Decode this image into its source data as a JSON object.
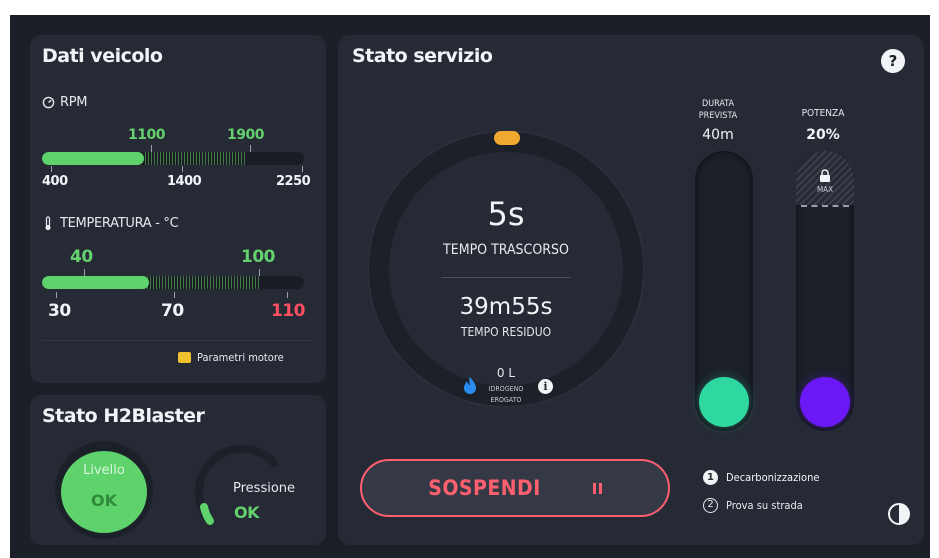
{
  "vehicle": {
    "title": "Dati veicolo",
    "rpm": {
      "label": "RPM",
      "range_low": "1100",
      "range_high": "1900",
      "scale_min": "400",
      "scale_mid": "1400",
      "scale_max": "2250",
      "current_fill": 0.39
    },
    "temperature": {
      "label": "TEMPERATURA - °C",
      "range_low": "40",
      "range_high": "100",
      "scale_min": "30",
      "scale_mid": "70",
      "scale_max": "110",
      "current_fill": 0.41
    },
    "engine_params_link": "Parametri motore"
  },
  "h2blaster": {
    "title": "Stato H2Blaster",
    "level_label": "Livello",
    "level_value": "OK",
    "pressure_label": "Pressione",
    "pressure_value": "OK"
  },
  "service": {
    "title": "Stato servizio",
    "help_icon_glyph": "?",
    "elapsed_value": "5s",
    "elapsed_label": "TEMPO TRASCORSO",
    "remaining_value": "39m55s",
    "remaining_label": "TEMPO RESIDUO",
    "hydrogen_value": "0 L",
    "hydrogen_label_1": "IDROGENO",
    "hydrogen_label_2": "EROGATO",
    "duration_label_1": "DURATA",
    "duration_label_2": "PREVISTA",
    "duration_value": "40m",
    "power_label": "POTENZA",
    "power_value": "20%",
    "power_max_label": "MAX",
    "suspend_button": "SOSPENDI",
    "steps": [
      {
        "number": "1",
        "label": "Decarbonizzazione",
        "active": true
      },
      {
        "number": "2",
        "label": "Prova su strada",
        "active": false
      }
    ]
  },
  "colors": {
    "green": "#5ed36b",
    "red": "#ff4f63",
    "teal": "#2fd8a0",
    "purple": "#6a18f5",
    "orange": "#f0a830",
    "background": "#1b1f28",
    "panel": "#262a35"
  }
}
